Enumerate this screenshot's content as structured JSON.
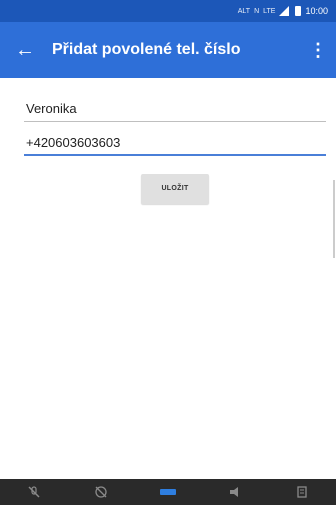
{
  "status_bar": {
    "carrier": "ALT",
    "network": "N",
    "lte": "LTE",
    "time": "10:00"
  },
  "app_bar": {
    "back_icon": "arrow-back-icon",
    "title": "Přidat povolené tel. číslo",
    "overflow_icon": "more-vert-icon"
  },
  "form": {
    "name_value": "Veronika",
    "phone_value": "+420603603603",
    "save_label": "ULOŽIT"
  },
  "bottom_bar": {
    "icons": [
      "mute-icon",
      "hold-icon",
      "keypad-icon",
      "speaker-icon",
      "contacts-icon"
    ],
    "accent": "#2e7ee0"
  },
  "colors": {
    "status_bar": "#1c57b8",
    "app_bar": "#2e6fd8",
    "field_focus": "#4a7fd8"
  }
}
